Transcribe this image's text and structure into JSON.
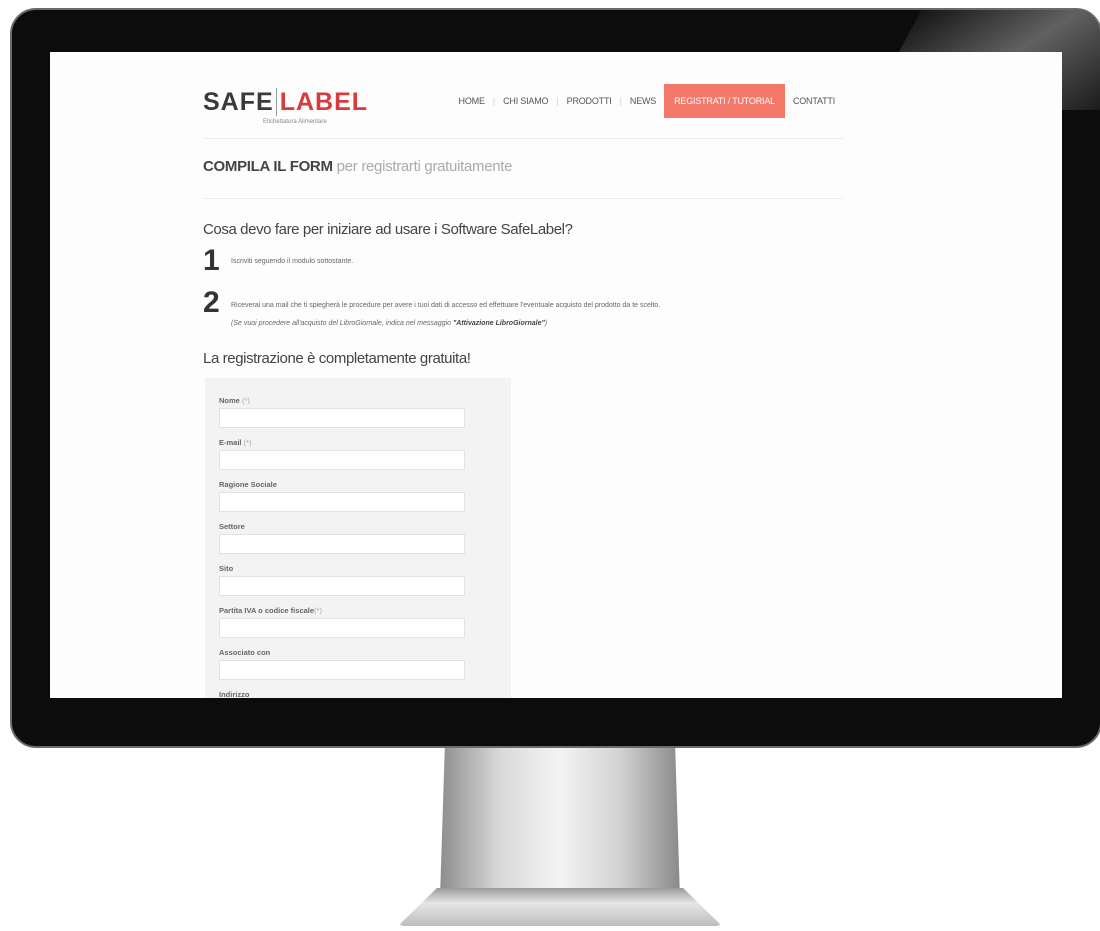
{
  "logo": {
    "part1": "SAFE",
    "part2": "LABEL",
    "tagline": "Etichettatura Alimentare"
  },
  "nav": {
    "items": [
      "HOME",
      "CHI SIAMO",
      "PRODOTTI",
      "NEWS",
      "REGISTRATI / TUTORIAL",
      "CONTATTI"
    ],
    "active_index": 4
  },
  "heading": {
    "bold": "COMPILA IL FORM",
    "light": "per registrarti gratuitamente"
  },
  "question": "Cosa devo fare per iniziare ad usare i Software SafeLabel?",
  "steps": [
    {
      "num": "1",
      "text": "Iscriviti seguendo il modulo sottostante."
    },
    {
      "num": "2",
      "text": "Riceverai una mail che ti spiegherà le procedure per avere i tuoi dati di accesso ed effettuare l'eventuale acquisto del prodotto da te scelto.",
      "note_prefix": "(Se vuoi procedere all'acquisto del LibroGiornale, indica nel messaggio ",
      "note_bold": "\"Attivazione LibroGiornale\"",
      "note_suffix": ")"
    }
  ],
  "free_text": "La registrazione è completamente gratuita!",
  "form": {
    "fields": [
      {
        "label": "Nome",
        "req": "(*)"
      },
      {
        "label": "E-mail",
        "req": "(*)"
      },
      {
        "label": "Ragione Sociale",
        "req": ""
      },
      {
        "label": "Settore",
        "req": ""
      },
      {
        "label": "Sito",
        "req": ""
      },
      {
        "label": "Partita IVA o codice fiscale",
        "req": "(*)"
      },
      {
        "label": "Associato con",
        "req": ""
      },
      {
        "label": "Indirizzo",
        "req": ""
      }
    ]
  },
  "colors": {
    "accent": "#f4786a",
    "logo_red": "#d63c3c",
    "bezel": "#0c0c0c"
  }
}
